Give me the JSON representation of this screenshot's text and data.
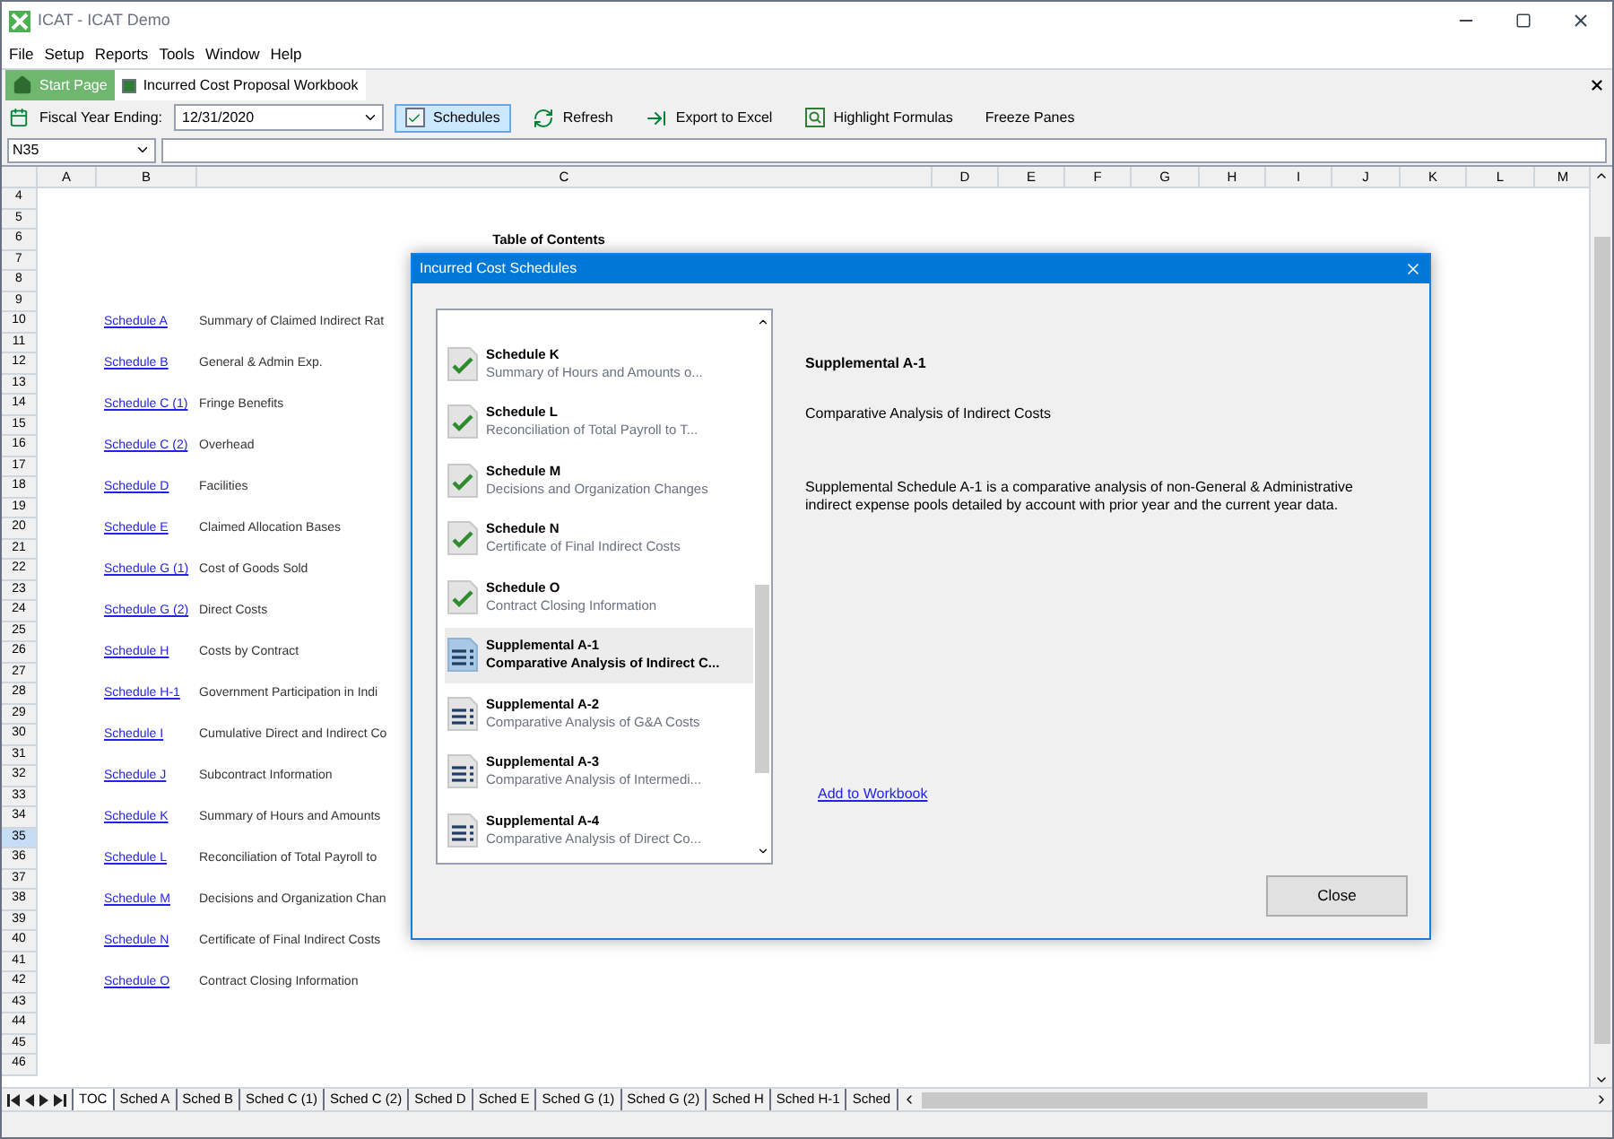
{
  "window": {
    "title": "ICAT - ICAT Demo"
  },
  "menu": [
    "File",
    "Setup",
    "Reports",
    "Tools",
    "Window",
    "Help"
  ],
  "doc_tabs": [
    {
      "label": "Start Page",
      "kind": "home",
      "selected": false
    },
    {
      "label": "Incurred Cost Proposal Workbook",
      "kind": "workbook",
      "selected": true
    }
  ],
  "toolbar": {
    "fiscal_label": "Fiscal Year Ending:",
    "fiscal_value": "12/31/2020",
    "buttons": [
      {
        "label": "Schedules",
        "kind": "check",
        "pressed": true
      },
      {
        "label": "Refresh",
        "kind": "refresh",
        "pressed": false
      },
      {
        "label": "Export to Excel",
        "kind": "export",
        "pressed": false
      },
      {
        "label": "Highlight Formulas",
        "kind": "highlight",
        "pressed": false
      },
      {
        "label": "Freeze Panes",
        "kind": "plain",
        "pressed": false
      }
    ]
  },
  "formula_bar": {
    "name_box": "N35"
  },
  "sheet": {
    "columns": [
      "A",
      "B",
      "C",
      "D",
      "E",
      "F",
      "G",
      "H",
      "I",
      "J",
      "K",
      "L",
      "M"
    ],
    "rows": [
      {
        "number": "4",
        "selected": false
      },
      {
        "number": "5",
        "selected": false
      },
      {
        "number": "6",
        "selected": false,
        "heading": "Table of Contents"
      },
      {
        "number": "7",
        "selected": false
      },
      {
        "number": "8",
        "selected": false
      },
      {
        "number": "9",
        "selected": false
      },
      {
        "number": "10",
        "selected": false,
        "link": "Schedule A",
        "text": "Summary of Claimed Indirect Rat"
      },
      {
        "number": "11",
        "selected": false
      },
      {
        "number": "12",
        "selected": false,
        "link": "Schedule B",
        "text": "General & Admin Exp."
      },
      {
        "number": "13",
        "selected": false
      },
      {
        "number": "14",
        "selected": false,
        "link": "Schedule C (1)",
        "text": "Fringe Benefits"
      },
      {
        "number": "15",
        "selected": false
      },
      {
        "number": "16",
        "selected": false,
        "link": "Schedule C (2)",
        "text": "Overhead"
      },
      {
        "number": "17",
        "selected": false
      },
      {
        "number": "18",
        "selected": false,
        "link": "Schedule D",
        "text": "Facilities"
      },
      {
        "number": "19",
        "selected": false
      },
      {
        "number": "20",
        "selected": false,
        "link": "Schedule E",
        "text": "Claimed Allocation Bases"
      },
      {
        "number": "21",
        "selected": false
      },
      {
        "number": "22",
        "selected": false,
        "link": "Schedule G (1)",
        "text": "Cost of Goods Sold"
      },
      {
        "number": "23",
        "selected": false
      },
      {
        "number": "24",
        "selected": false,
        "link": "Schedule G (2)",
        "text": "Direct Costs"
      },
      {
        "number": "25",
        "selected": false
      },
      {
        "number": "26",
        "selected": false,
        "link": "Schedule H",
        "text": "Costs by Contract"
      },
      {
        "number": "27",
        "selected": false
      },
      {
        "number": "28",
        "selected": false,
        "link": "Schedule H-1",
        "text": "Government Participation in Indi"
      },
      {
        "number": "29",
        "selected": false
      },
      {
        "number": "30",
        "selected": false,
        "link": "Schedule I",
        "text": "Cumulative Direct and Indirect Co"
      },
      {
        "number": "31",
        "selected": false
      },
      {
        "number": "32",
        "selected": false,
        "link": "Schedule J",
        "text": "Subcontract Information"
      },
      {
        "number": "33",
        "selected": false
      },
      {
        "number": "34",
        "selected": false,
        "link": "Schedule K",
        "text": "Summary of Hours and Amounts"
      },
      {
        "number": "35",
        "selected": true
      },
      {
        "number": "36",
        "selected": false,
        "link": "Schedule L",
        "text": "Reconciliation of Total Payroll to"
      },
      {
        "number": "37",
        "selected": false
      },
      {
        "number": "38",
        "selected": false,
        "link": "Schedule M",
        "text": "Decisions and Organization Chan"
      },
      {
        "number": "39",
        "selected": false
      },
      {
        "number": "40",
        "selected": false,
        "link": "Schedule N",
        "text": "Certificate of Final Indirect Costs"
      },
      {
        "number": "41",
        "selected": false
      },
      {
        "number": "42",
        "selected": false,
        "link": "Schedule O",
        "text": "Contract Closing Information"
      },
      {
        "number": "43",
        "selected": false
      },
      {
        "number": "44",
        "selected": false
      },
      {
        "number": "45",
        "selected": false
      },
      {
        "number": "46",
        "selected": false
      }
    ]
  },
  "sheet_tabs": [
    {
      "label": "TOC",
      "selected": true
    },
    {
      "label": "Sched A",
      "selected": false
    },
    {
      "label": "Sched B",
      "selected": false
    },
    {
      "label": "Sched C (1)",
      "selected": false
    },
    {
      "label": "Sched C (2)",
      "selected": false
    },
    {
      "label": "Sched D",
      "selected": false
    },
    {
      "label": "Sched E",
      "selected": false
    },
    {
      "label": "Sched G (1)",
      "selected": false
    },
    {
      "label": "Sched G (2)",
      "selected": false
    },
    {
      "label": "Sched H",
      "selected": false
    },
    {
      "label": "Sched H-1",
      "selected": false
    },
    {
      "label": "Sched",
      "selected": false
    }
  ],
  "dialog": {
    "title": "Incurred Cost Schedules",
    "items": [
      {
        "kind": "done",
        "title": "Schedule K",
        "subtitle": "Summary of Hours and Amounts o...",
        "selected": false
      },
      {
        "kind": "done",
        "title": "Schedule L",
        "subtitle": "Reconciliation of Total Payroll to T...",
        "selected": false
      },
      {
        "kind": "done",
        "title": "Schedule M",
        "subtitle": "Decisions and Organization Changes",
        "selected": false
      },
      {
        "kind": "done",
        "title": "Schedule N",
        "subtitle": "Certificate of Final Indirect Costs",
        "selected": false
      },
      {
        "kind": "done",
        "title": "Schedule O",
        "subtitle": "Contract Closing Information",
        "selected": false
      },
      {
        "kind": "document",
        "title": "Supplemental A-1",
        "subtitle": "Comparative Analysis of Indirect C...",
        "selected": true
      },
      {
        "kind": "document",
        "title": "Supplemental A-2",
        "subtitle": "Comparative Analysis of G&A Costs",
        "selected": false
      },
      {
        "kind": "document",
        "title": "Supplemental A-3",
        "subtitle": "Comparative Analysis of Intermedi...",
        "selected": false
      },
      {
        "kind": "document",
        "title": "Supplemental A-4",
        "subtitle": "Comparative Analysis of Direct Co...",
        "selected": false
      }
    ],
    "detail": {
      "title": "Supplemental A-1",
      "subtitle": "Comparative Analysis of Indirect Costs",
      "description": "Supplemental Schedule A-1 is a comparative analysis of non-General & Administrative indirect expense pools detailed by account with prior year and the current year data."
    },
    "link": "Add to Workbook",
    "button": "Close"
  }
}
